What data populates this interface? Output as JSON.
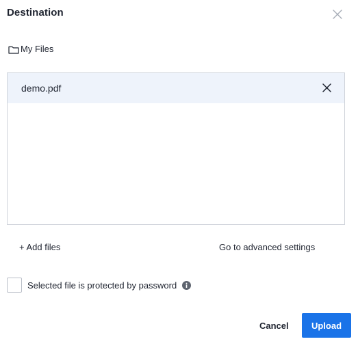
{
  "dialog": {
    "title": "Destination",
    "close_icon": "close-icon"
  },
  "folder": {
    "icon": "folder-icon",
    "label": "My Files"
  },
  "files": [
    {
      "name": "demo.pdf",
      "remove_icon": "close-icon"
    }
  ],
  "actions": {
    "add_files": "+ Add files",
    "advanced_settings": "Go to advanced settings"
  },
  "password": {
    "checked": false,
    "label": "Selected file is protected by password",
    "info_icon": "info-icon"
  },
  "footer": {
    "cancel_label": "Cancel",
    "upload_label": "Upload"
  },
  "colors": {
    "accent": "#1a73e8",
    "selected_row": "#eef3fb",
    "border": "#cfd3da"
  }
}
